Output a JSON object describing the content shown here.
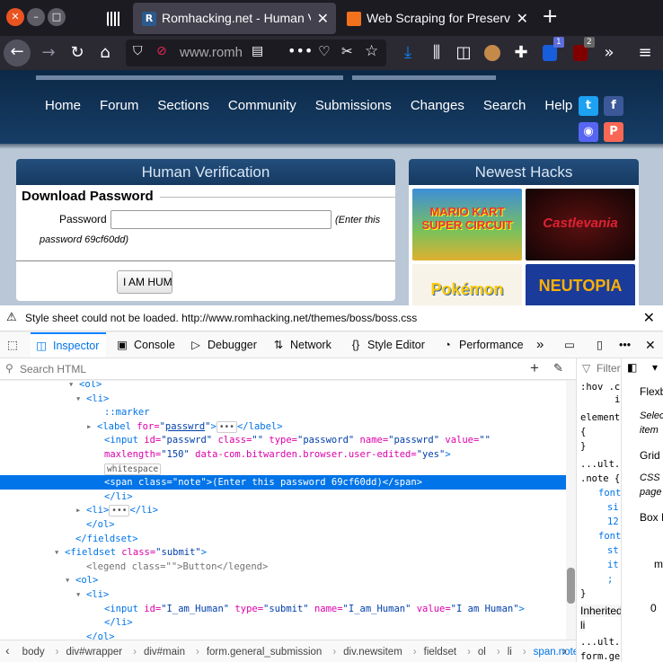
{
  "browser": {
    "tabs": [
      {
        "title": "",
        "pinned": true
      },
      {
        "title": "Romhacking.net - Human Verification",
        "active": true
      },
      {
        "title": "Web Scraping for Preservation"
      }
    ],
    "url": "www.romh",
    "badges": {
      "bitwarden": "1",
      "ublock": "2"
    }
  },
  "site": {
    "menu": [
      "Home",
      "Forum",
      "Sections",
      "Community",
      "Submissions",
      "Changes",
      "Search",
      "Help"
    ],
    "verification": {
      "heading": "Human Verification",
      "legend": "Download Password",
      "password_label": "Password",
      "note_a": "(Enter this",
      "note_b": "password 69cf60dd)",
      "button": "I AM HUMAN"
    },
    "hacks": {
      "heading": "Newest Hacks",
      "thumbs": [
        "MARIO KART SUPER CIRCUIT",
        "Castlevania",
        "Pokémon",
        "NEUTOPIA"
      ]
    }
  },
  "warning": "Style sheet could not be loaded. http://www.romhacking.net/themes/boss/boss.css",
  "devtools": {
    "tabs": [
      "Inspector",
      "Console",
      "Debugger",
      "Network",
      "Style Editor",
      "Performance"
    ],
    "search_placeholder": "Search HTML",
    "markup": [
      {
        "indent": 88,
        "tw": "▾",
        "html": "<span class=\"tag\">&lt;ol&gt;</span>"
      },
      {
        "indent": 96,
        "tw": "▾",
        "html": "<span class=\"tag\">&lt;li&gt;</span>"
      },
      {
        "indent": 116,
        "tw": "",
        "html": "<span class=\"tag\">::marker</span>"
      },
      {
        "indent": 108,
        "tw": "▸",
        "html": "<span class=\"tag\">&lt;label</span> <span class=\"attr\">for=</span><span class=\"val\">\"<u>passwrd</u>\"</span><span class=\"tag\">&gt;</span><span class=\"ws\">•••</span><span class=\"tag\">&lt;/label&gt;</span>"
      },
      {
        "indent": 116,
        "tw": "",
        "html": "<span class=\"tag\">&lt;input</span> <span class=\"attr\">id=</span><span class=\"val\">\"passwrd\"</span> <span class=\"attr\">class=</span><span class=\"val\">\"\"</span> <span class=\"attr\">type=</span><span class=\"val\">\"password\"</span> <span class=\"attr\">name=</span><span class=\"val\">\"passwrd\"</span> <span class=\"attr\">value=</span><span class=\"val\">\"\"</span>"
      },
      {
        "indent": 116,
        "tw": "",
        "html": "<span class=\"attr\">maxlength=</span><span class=\"val\">\"150\"</span> <span class=\"attr\">data-com.bitwarden.browser.user-edited=</span><span class=\"val\">\"yes\"</span><span class=\"tag\">&gt;</span>"
      },
      {
        "indent": 116,
        "tw": "",
        "html": "<span class=\"ws\">whitespace</span>"
      },
      {
        "indent": 116,
        "tw": "",
        "sel": true,
        "html": "<span class=\"tag\">&lt;span</span> <span class=\"attr\">class=</span><span class=\"val\">\"note\"</span><span class=\"tag\">&gt;</span>(Enter this password 69cf60dd)<span class=\"tag\">&lt;/span&gt;</span>"
      },
      {
        "indent": 116,
        "tw": "",
        "html": "<span class=\"tag\">&lt;/li&gt;</span>"
      },
      {
        "indent": 96,
        "tw": "▸",
        "html": "<span class=\"tag\">&lt;li&gt;</span><span class=\"ws\">•••</span><span class=\"tag\">&lt;/li&gt;</span>"
      },
      {
        "indent": 96,
        "tw": "",
        "html": "<span class=\"tag\">&lt;/ol&gt;</span>"
      },
      {
        "indent": 84,
        "tw": "",
        "html": "<span class=\"tag\">&lt;/fieldset&gt;</span>"
      },
      {
        "indent": 72,
        "tw": "▾",
        "html": "<span class=\"tag\">&lt;fieldset</span> <span class=\"attr\">class=</span><span class=\"val\">\"submit\"</span><span class=\"tag\">&gt;</span>"
      },
      {
        "indent": 96,
        "tw": "",
        "html": "<span class=\"gray\">&lt;legend class=\"\"&gt;Button&lt;/legend&gt;</span>"
      },
      {
        "indent": 84,
        "tw": "▾",
        "html": "<span class=\"tag\">&lt;ol&gt;</span>"
      },
      {
        "indent": 96,
        "tw": "▾",
        "html": "<span class=\"tag\">&lt;li&gt;</span>"
      },
      {
        "indent": 116,
        "tw": "",
        "html": "<span class=\"tag\">&lt;input</span> <span class=\"attr\">id=</span><span class=\"val\">\"I_am_Human\"</span> <span class=\"attr\">type=</span><span class=\"val\">\"submit\"</span> <span class=\"attr\">name=</span><span class=\"val\">\"I_am_Human\"</span> <span class=\"attr\">value=</span><span class=\"val\">\"I am Human\"</span><span class=\"tag\">&gt;</span>"
      },
      {
        "indent": 116,
        "tw": "",
        "html": "<span class=\"tag\">&lt;/li&gt;</span>"
      },
      {
        "indent": 96,
        "tw": "",
        "html": "<span class=\"tag\">&lt;/ol&gt;</span>"
      }
    ],
    "breadcrumbs": [
      "body",
      "div#wrapper",
      "div#main",
      "form.general_submission",
      "div.newsitem",
      "fieldset",
      "ol",
      "li",
      "span.note"
    ],
    "rules_lines": [
      ":hov .cl",
      "i",
      "element",
      "{",
      "}",
      "...ult.cs",
      ".note {",
      "font",
      "si",
      "12",
      "font",
      "st",
      "it",
      ";",
      "}",
      "Inherited",
      "li",
      "...ult.cs",
      "form.ge"
    ],
    "layout_lines": [
      "Flexb",
      "Selec",
      "item",
      "Grid",
      "CSS G",
      "page",
      "Box M",
      "ma",
      "0"
    ],
    "rules_filter": "Filter"
  }
}
